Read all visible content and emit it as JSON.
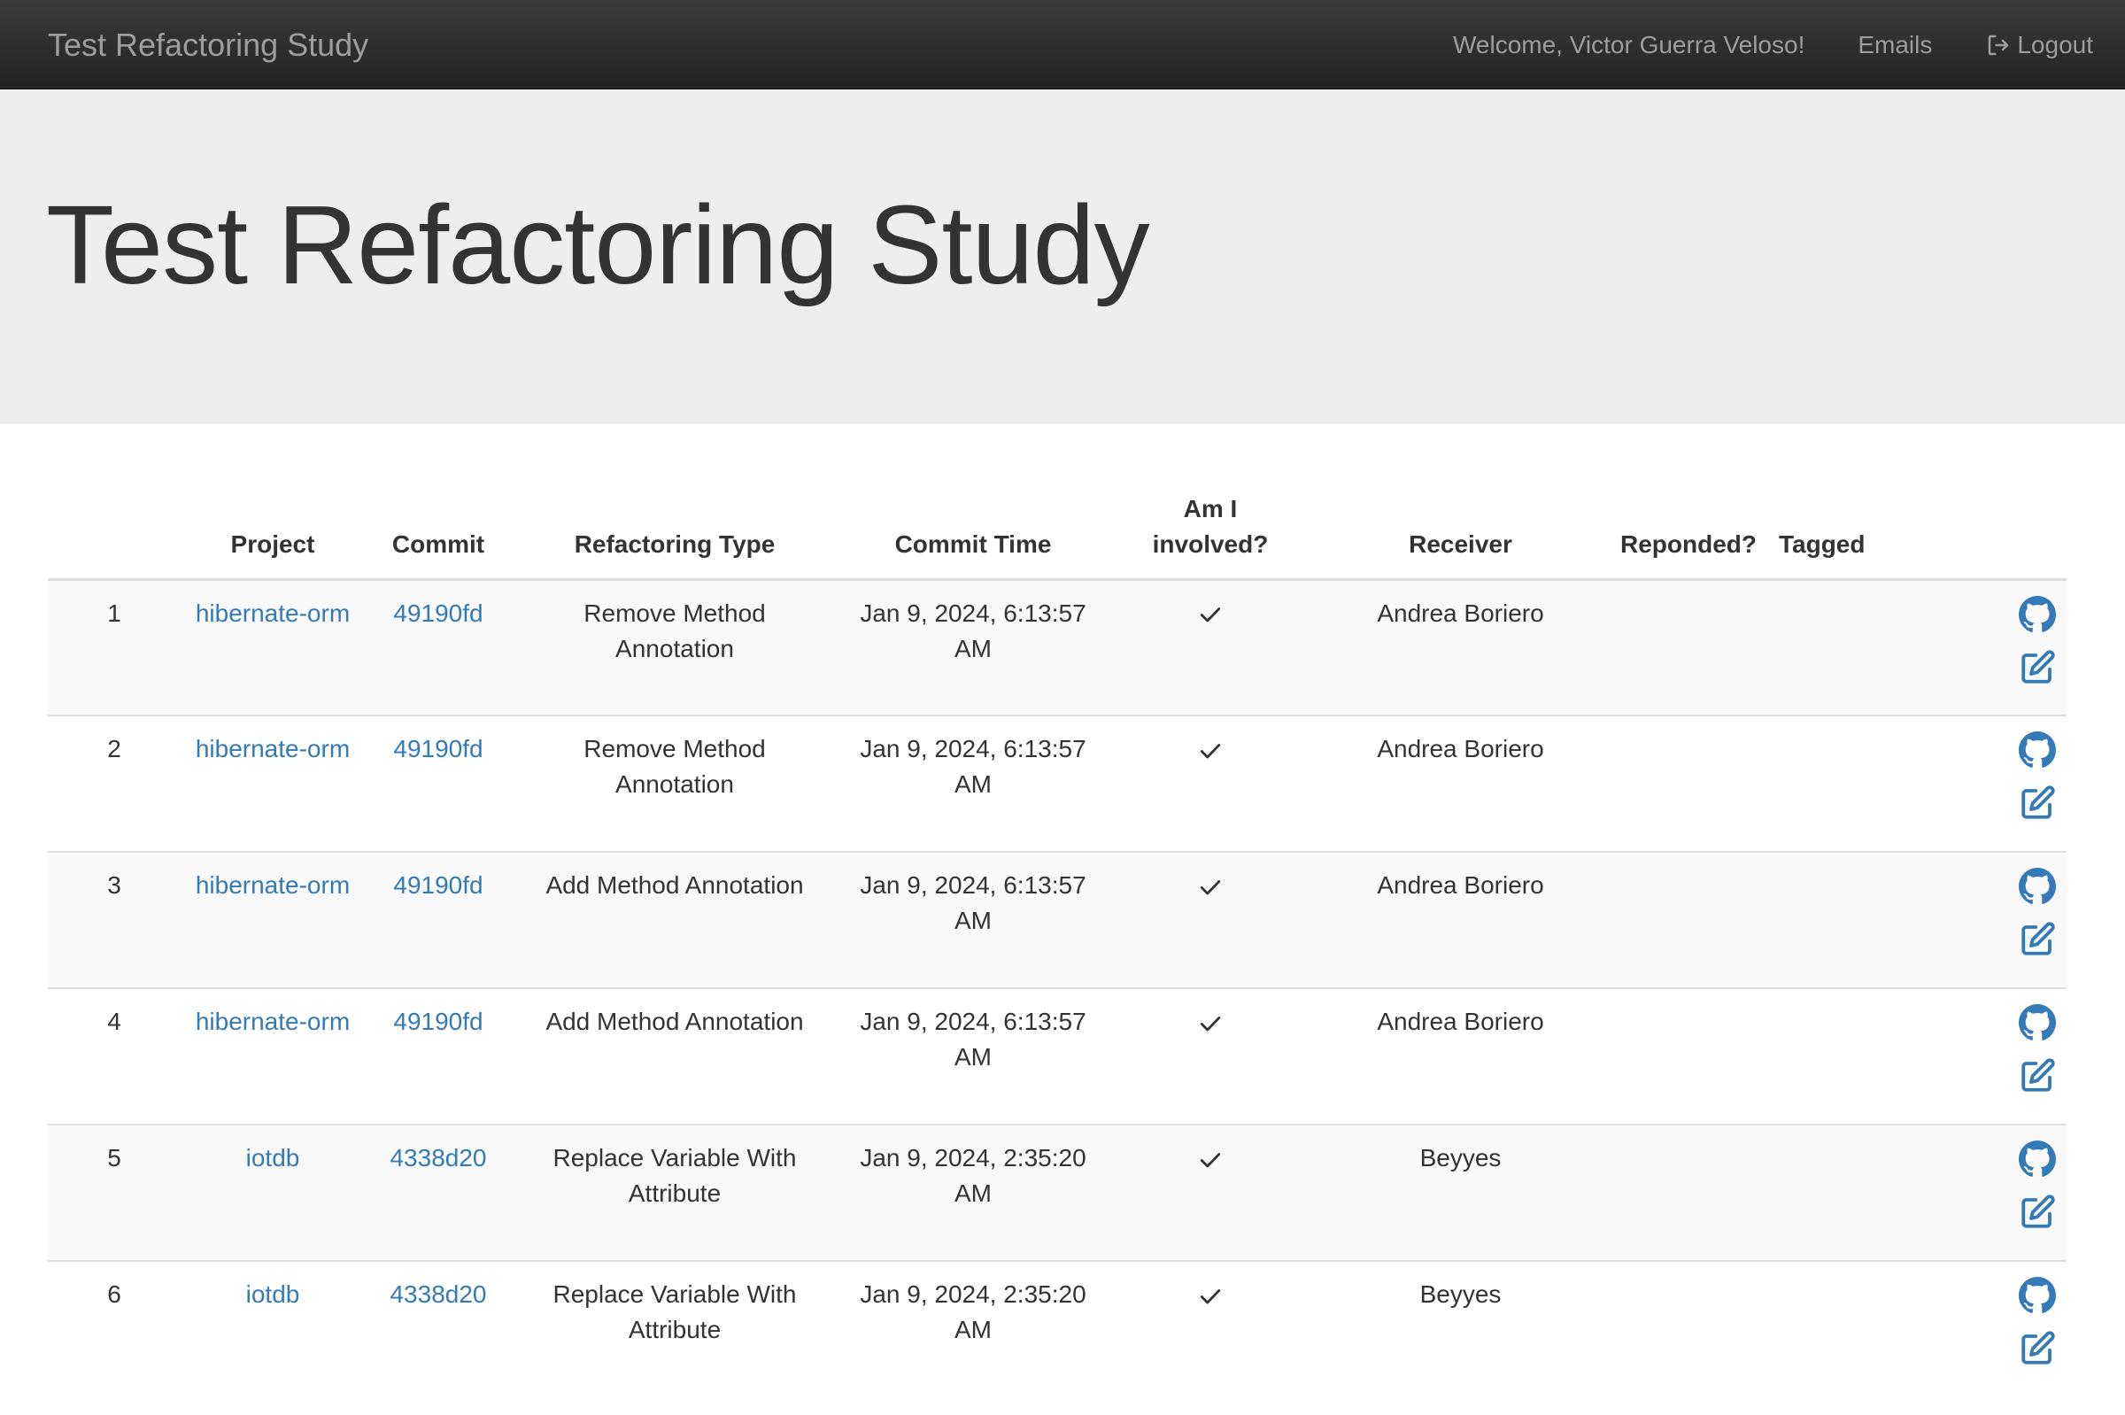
{
  "navbar": {
    "brand": "Test Refactoring Study",
    "welcome": "Welcome, Victor Guerra Veloso!",
    "emails": "Emails",
    "logout": "Logout"
  },
  "jumbotron": {
    "title": "Test Refactoring Study"
  },
  "table": {
    "headers": {
      "num": "",
      "project": "Project",
      "commit": "Commit",
      "type": "Refactoring Type",
      "time": "Commit Time",
      "involved_1": "Am I",
      "involved_2": "involved?",
      "receiver": "Receiver",
      "responded": "Reponded?",
      "tagged": "Tagged"
    },
    "rows": [
      {
        "num": "1",
        "project": "hibernate-orm",
        "commit": "49190fd",
        "type": "Remove Method Annotation",
        "time": "Jan 9, 2024, 6:13:57 AM",
        "involved": "check-icon",
        "receiver": "Andrea Boriero",
        "responded": "",
        "tagged": ""
      },
      {
        "num": "2",
        "project": "hibernate-orm",
        "commit": "49190fd",
        "type": "Remove Method Annotation",
        "time": "Jan 9, 2024, 6:13:57 AM",
        "involved": "check-icon",
        "receiver": "Andrea Boriero",
        "responded": "",
        "tagged": ""
      },
      {
        "num": "3",
        "project": "hibernate-orm",
        "commit": "49190fd",
        "type": "Add Method Annotation",
        "time": "Jan 9, 2024, 6:13:57 AM",
        "involved": "check-icon",
        "receiver": "Andrea Boriero",
        "responded": "",
        "tagged": ""
      },
      {
        "num": "4",
        "project": "hibernate-orm",
        "commit": "49190fd",
        "type": "Add Method Annotation",
        "time": "Jan 9, 2024, 6:13:57 AM",
        "involved": "check-icon",
        "receiver": "Andrea Boriero",
        "responded": "",
        "tagged": ""
      },
      {
        "num": "5",
        "project": "iotdb",
        "commit": "4338d20",
        "type": "Replace Variable With Attribute",
        "time": "Jan 9, 2024, 2:35:20 AM",
        "involved": "check-icon",
        "receiver": "Beyyes",
        "responded": "",
        "tagged": ""
      },
      {
        "num": "6",
        "project": "iotdb",
        "commit": "4338d20",
        "type": "Replace Variable With Attribute",
        "time": "Jan 9, 2024, 2:35:20 AM",
        "involved": "check-icon",
        "receiver": "Beyyes",
        "responded": "",
        "tagged": ""
      }
    ],
    "row_actions": [
      "github-icon",
      "edit-icon"
    ]
  },
  "colors": {
    "link": "#337ab7",
    "navbar": "#222222",
    "jumbotron": "#eeeeee"
  }
}
